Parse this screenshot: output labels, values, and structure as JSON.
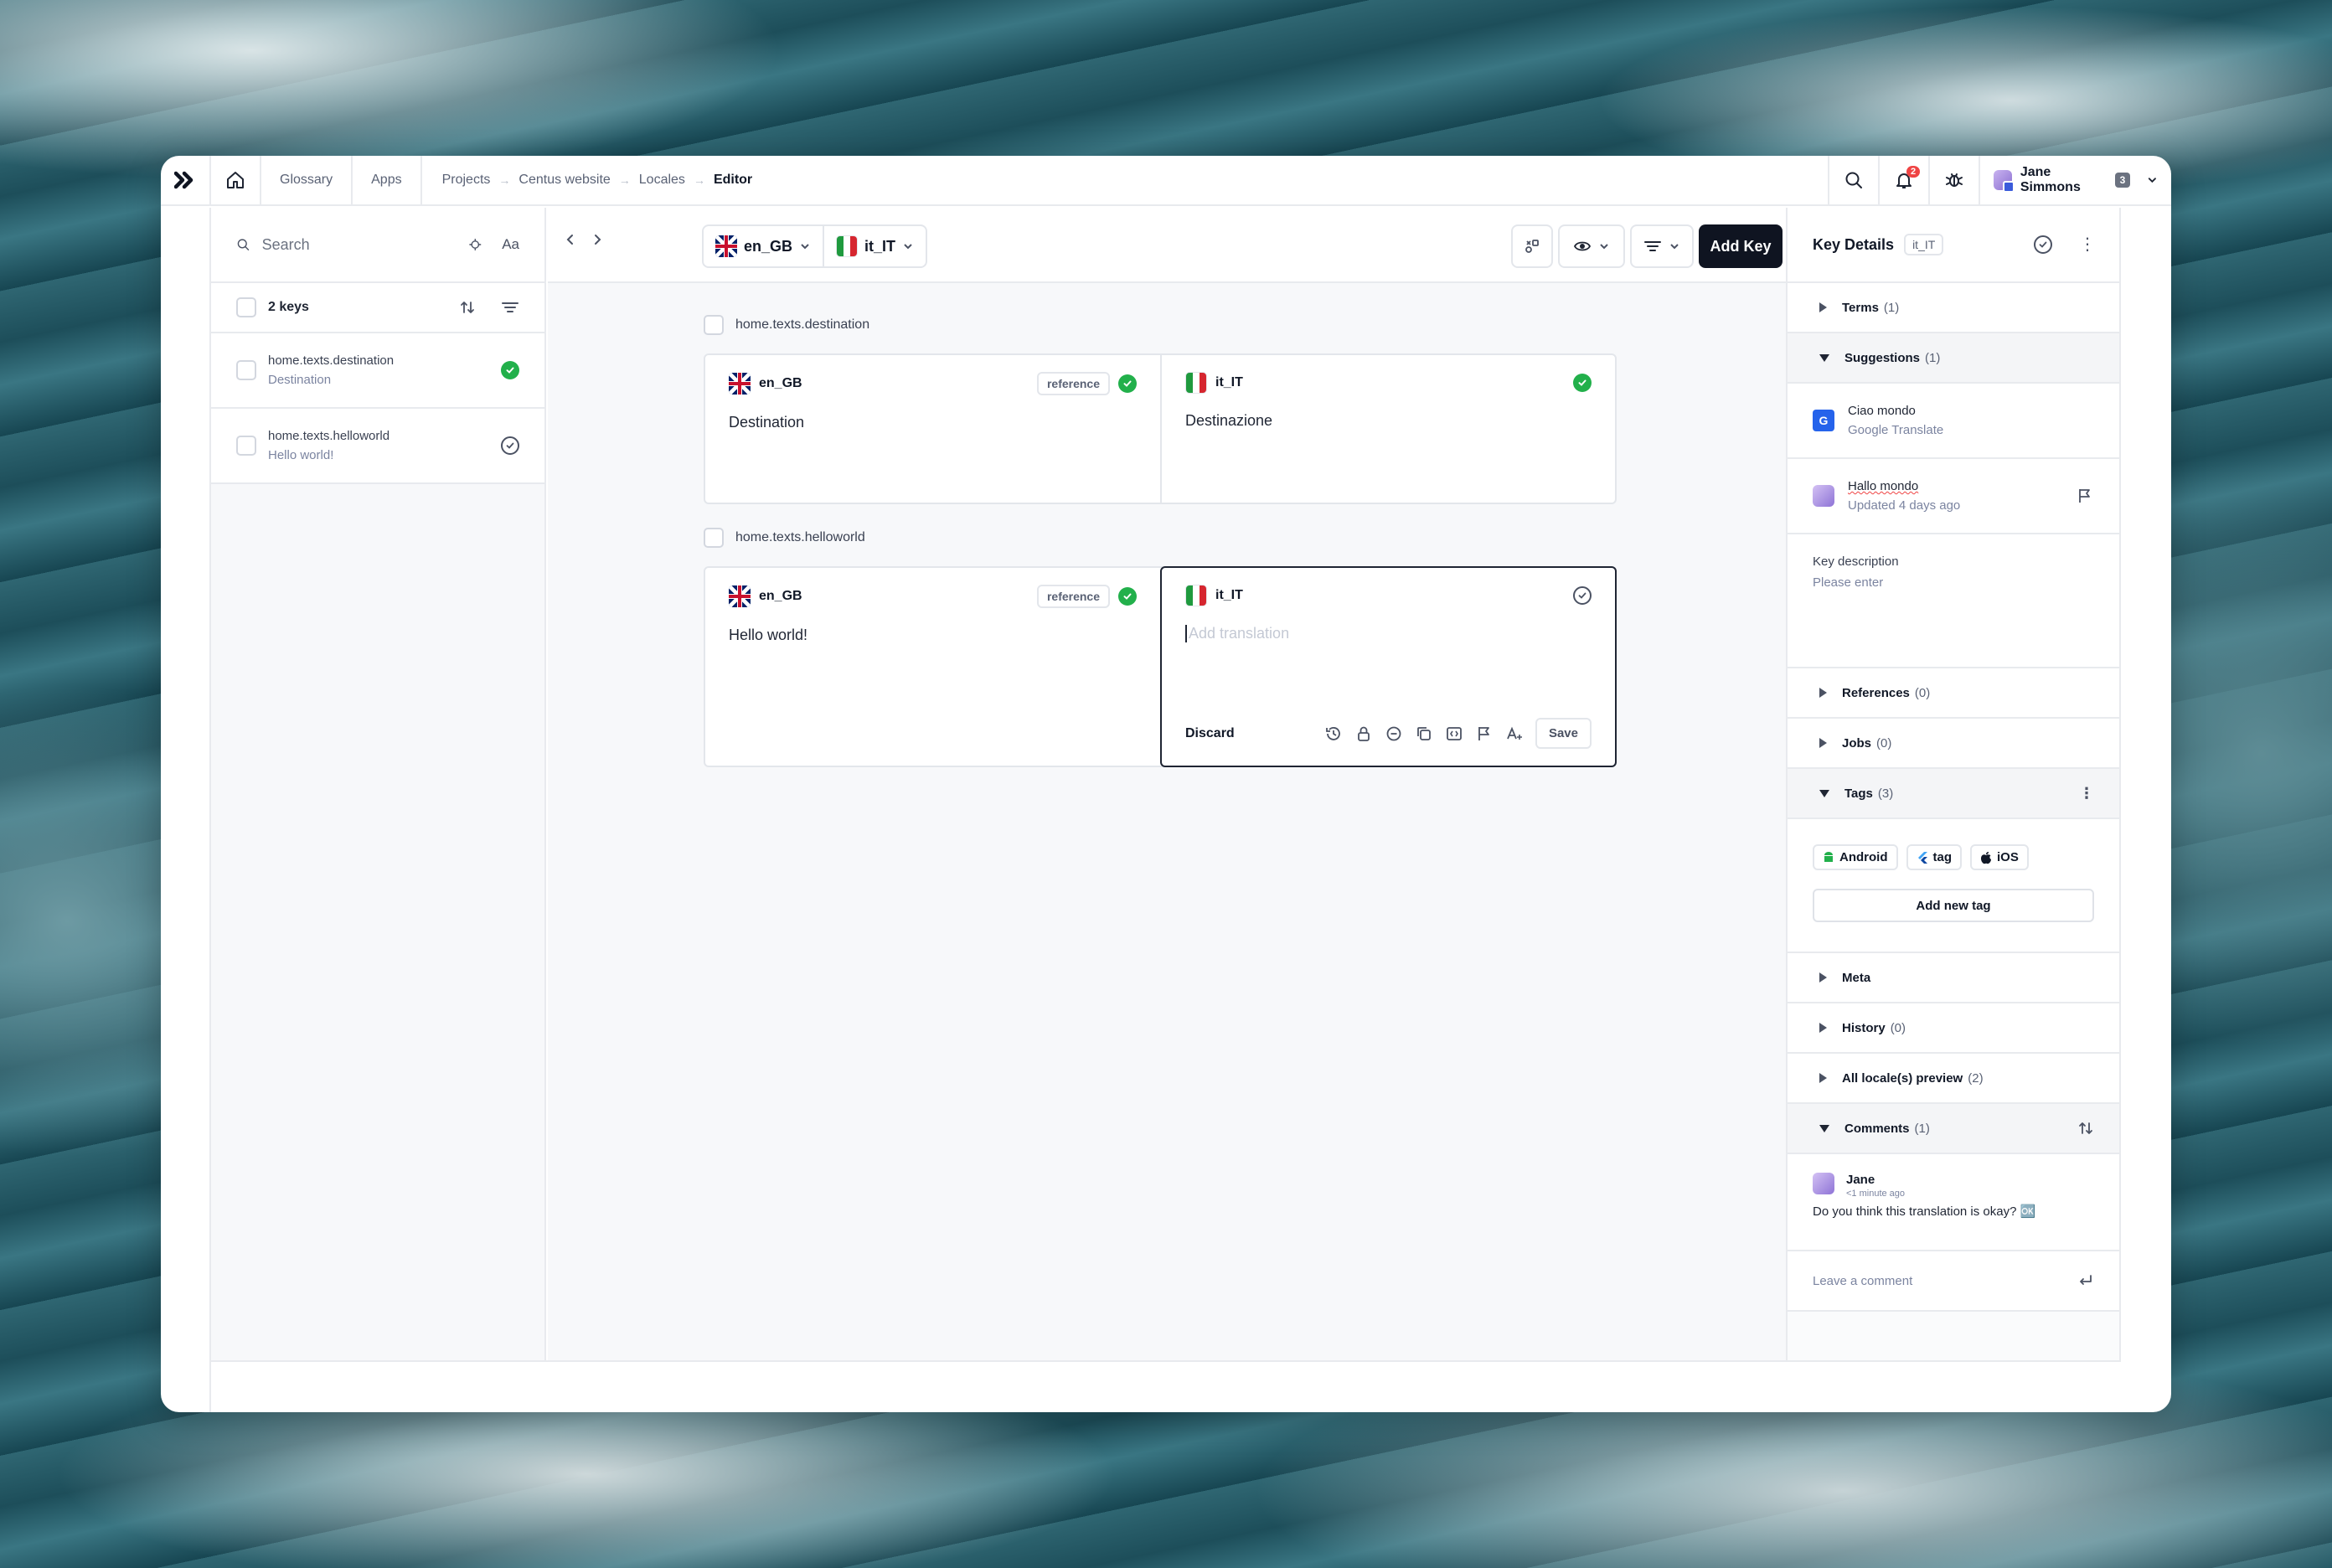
{
  "topnav": {
    "links": [
      "Glossary",
      "Apps"
    ],
    "breadcrumb": [
      "Projects",
      "Centus website",
      "Locales",
      "Editor"
    ],
    "notifications_count": "2",
    "user_name": "Jane Simmons",
    "user_badge": "3"
  },
  "sidebar": {
    "search_placeholder": "Search",
    "keys_count_label": "2 keys",
    "items": [
      {
        "key": "home.texts.destination",
        "value": "Destination",
        "status": "translated"
      },
      {
        "key": "home.texts.helloworld",
        "value": "Hello world!",
        "status": "pending"
      }
    ]
  },
  "toolbar": {
    "source_locale": "en_GB",
    "target_locale": "it_IT",
    "add_key_label": "Add Key"
  },
  "keys": [
    {
      "name": "home.texts.destination",
      "source": {
        "locale": "en_GB",
        "tag": "reference",
        "text": "Destination"
      },
      "target": {
        "locale": "it_IT",
        "text": "Destinazione"
      }
    },
    {
      "name": "home.texts.helloworld",
      "source": {
        "locale": "en_GB",
        "tag": "reference",
        "text": "Hello world!"
      },
      "target": {
        "locale": "it_IT",
        "placeholder": "Add translation"
      },
      "editor": {
        "discard_label": "Discard",
        "save_label": "Save"
      }
    }
  ],
  "key_details": {
    "title": "Key Details",
    "locale": "it_IT",
    "terms": {
      "label": "Terms",
      "count": "(1)"
    },
    "suggestions": {
      "label": "Suggestions",
      "count": "(1)",
      "items": [
        {
          "text": "Ciao mondo",
          "source": "Google Translate"
        },
        {
          "text": "Hallo mondo",
          "source": "Updated 4 days ago"
        }
      ]
    },
    "description": {
      "label": "Key description",
      "placeholder": "Please enter"
    },
    "references": {
      "label": "References",
      "count": "(0)"
    },
    "jobs": {
      "label": "Jobs",
      "count": "(0)"
    },
    "tags": {
      "label": "Tags",
      "count": "(3)",
      "items": [
        "Android",
        "tag",
        "iOS"
      ],
      "add_label": "Add  new tag"
    },
    "meta": {
      "label": "Meta"
    },
    "history": {
      "label": "History",
      "count": "(0)"
    },
    "preview": {
      "label": "All locale(s) preview",
      "count": "(2)"
    },
    "comments": {
      "label": "Comments",
      "count": "(1)",
      "items": [
        {
          "author": "Jane",
          "time": "<1 minute ago",
          "text": "Do you think this translation is okay? 🆗"
        }
      ],
      "placeholder": "Leave a comment"
    }
  }
}
